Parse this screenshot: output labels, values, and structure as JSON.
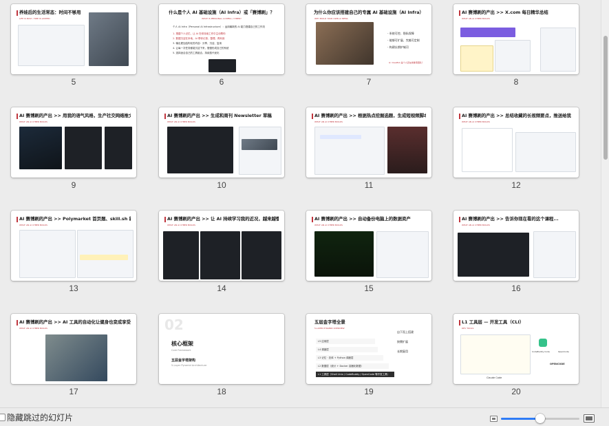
{
  "slides": [
    {
      "number": "5",
      "title": "养娃后的生活常态：时间不够用",
      "subtitle": "LIFE IS BUSY, TIME IS LIMITED"
    },
    {
      "number": "6",
      "title": "什么是个人 AI 基础设施（AI Infra）或「赛博刷」？",
      "subtitle": "WHAT IS PERSONAL AI INFRA / CYBER?",
      "body": [
        "个人 AI Infra（Personal AI Infrastructure）：运用最新的 AI 能力搭建自己的工作流",
        "1. 搭建个人记忆，让 AI 在你持续工作中主动帮你",
        "2. 数据沉淀在本地，AI 帮你记录、整理、再利用",
        "3. 输出更加结构化的内容：分享、沉淀、复用",
        "4. 让每一次任务都能沉淀下来，慢慢形成自己的系统",
        "5. 选择适合自己的工具组合，持续迭代优化"
      ]
    },
    {
      "number": "7",
      "title": "为什么你应该搭建自己的专属 AI 基础设施（AI Infra）",
      "subtitle": "WHY BUILD YOUR OWN AI INFRA",
      "bullets": [
        "- 系统可控、隐私保障",
        "- 能够可扩展、完美可定制",
        "- 构建长期护城河"
      ],
      "footnote": "Q: ClawBot 是个人还在线等待团队？"
    },
    {
      "number": "8",
      "title": "AI 赛博刷的产出 >> X.com 每日精华总结",
      "subtitle": "WHAT AN AI CYBER BUILDS"
    },
    {
      "number": "9",
      "title": "AI 赛博刷的产出 >> 用我的语气风格，生产社交网络推文",
      "subtitle": "WHAT AN AI CYBER BUILDS"
    },
    {
      "number": "10",
      "title": "AI 赛博刷的产出 >> 生成和周刊 Newsletter 草稿",
      "subtitle": "WHAT AN AI CYBER BUILDS"
    },
    {
      "number": "11",
      "title": "AI 赛博刷的产出 >> 根据热点挖掘选题，生成短视频脚本",
      "subtitle": "WHAT AN AI CYBER BUILDS"
    },
    {
      "number": "12",
      "title": "AI 赛博刷的产出 >> 总结收藏的长视频要点，推送给我",
      "subtitle": "WHAT AN AI CYBER BUILDS"
    },
    {
      "number": "13",
      "title": "AI 赛博刷的产出 >> Polymarket 首页题、skill.sh 新技能",
      "subtitle": "WHAT AN AI CYBER BUILDS"
    },
    {
      "number": "14",
      "title": "AI 赛博刷的产出 >> 让 AI 持续学习我的近况，越来越懂我",
      "subtitle": "WHAT AN AI CYBER BUILDS"
    },
    {
      "number": "15",
      "title": "AI 赛博刷的产出 >> 自动备份电脑上的数据资产",
      "subtitle": "WHAT AN AI CYBER BUILDS"
    },
    {
      "number": "16",
      "title": "AI 赛博刷的产出 >> 告诉你现在看的这个课程...",
      "subtitle": "WHAT AN AI CYBER BUILDS"
    },
    {
      "number": "17",
      "title": "AI 赛博刷的产出 >> AI 工具的自动化让健身也变成享受",
      "subtitle": "WHAT AN AI CYBER BUILDS"
    },
    {
      "number": "18",
      "big_number": "02",
      "title": "核心框架",
      "subtitle": "Core Framework",
      "title2": "五层金字塔架构",
      "subtitle2": "5-Layer Pyramid Architecture"
    },
    {
      "number": "19",
      "title": "五层金字塔全景",
      "subtitle": "5-LAYER PYRAMID OVERVIEW",
      "layers": [
        "L5 应用层",
        "L4 调度层",
        "L3 记忆 · 总体 + Python 调度层",
        "L2 数据层（统计 + Docker 容器化数据）",
        "L1 工具层（Shell Unix / CodeBuddy / OpenCode 等开发工具）"
      ],
      "side_labels": [
        "自下而上搭建",
        "按需扩展",
        "长期复用"
      ]
    },
    {
      "number": "20",
      "title": "L1 工具层 — 开发工具（CLI）",
      "subtitle": "DEV TOOLS",
      "caption_left": "Claude Code",
      "caption_right_1": "CodeBuddy Code",
      "caption_right_2": "OpenCode",
      "logo": "OPENCODE"
    }
  ],
  "footer": {
    "hide_skipped_label": "隐藏跳过的幻灯片",
    "zoom_level": 0.5
  },
  "colors": {
    "accent": "#c0353d",
    "slider_fill": "#2f7cf6"
  }
}
